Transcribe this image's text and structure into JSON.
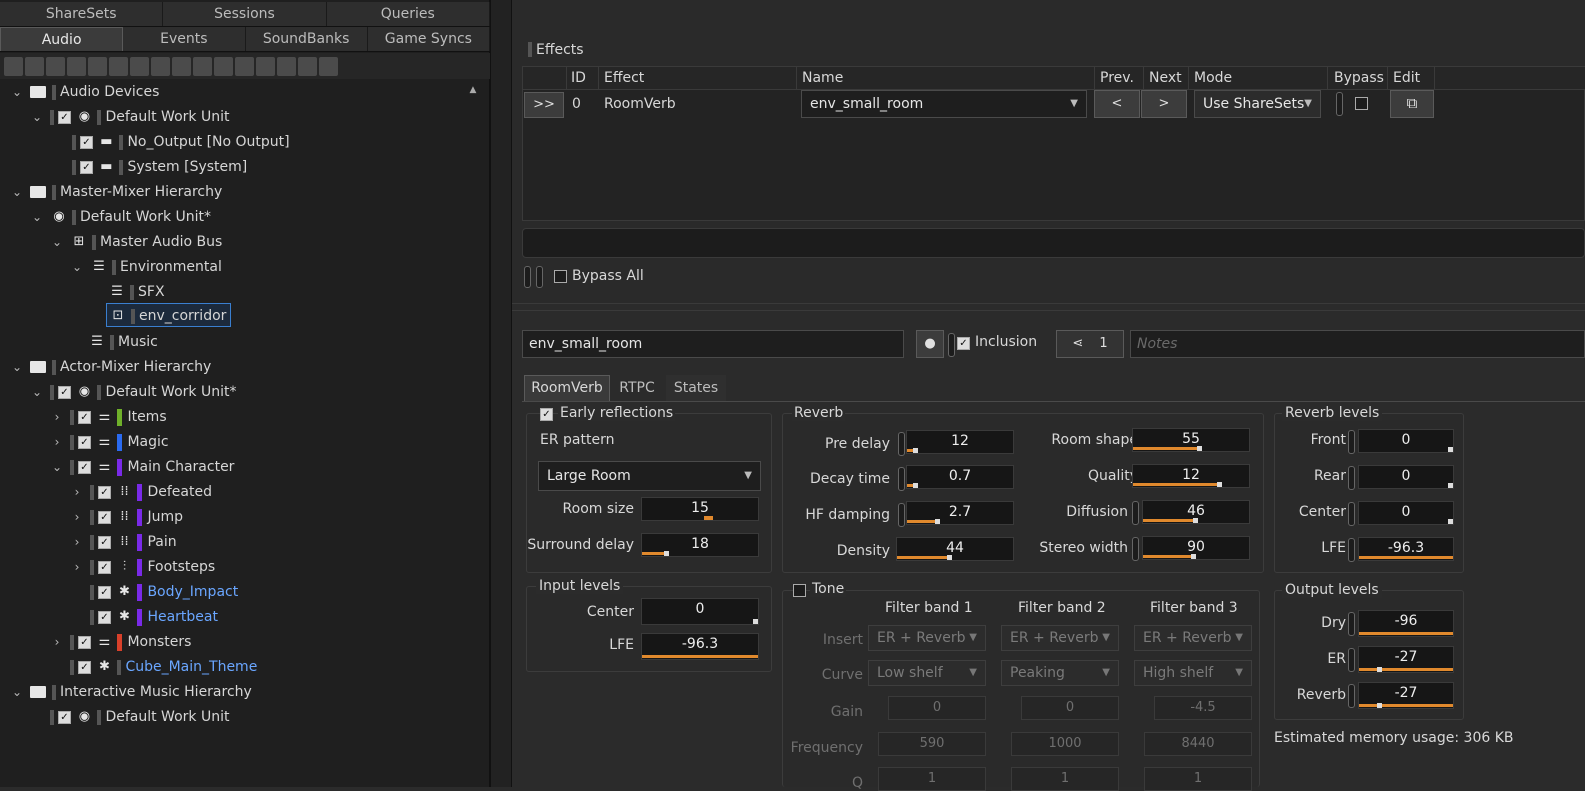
{
  "left_tabs_top": [
    "ShareSets",
    "Sessions",
    "Queries"
  ],
  "left_tabs_bottom": [
    "Audio",
    "Events",
    "SoundBanks",
    "Game Syncs"
  ],
  "tree": [
    {
      "label": "Audio Devices"
    },
    {
      "label": "Default Work Unit"
    },
    {
      "label": "No_Output [No Output]"
    },
    {
      "label": "System [System]"
    },
    {
      "label": "Master-Mixer Hierarchy"
    },
    {
      "label": "Default Work Unit*"
    },
    {
      "label": "Master Audio Bus"
    },
    {
      "label": "Environmental"
    },
    {
      "label": "SFX"
    },
    {
      "label": "env_corridor"
    },
    {
      "label": "Music"
    },
    {
      "label": "Actor-Mixer Hierarchy"
    },
    {
      "label": "Default Work Unit*"
    },
    {
      "label": "Items"
    },
    {
      "label": "Magic"
    },
    {
      "label": "Main Character"
    },
    {
      "label": "Defeated"
    },
    {
      "label": "Jump"
    },
    {
      "label": "Pain"
    },
    {
      "label": "Footsteps"
    },
    {
      "label": "Body_Impact"
    },
    {
      "label": "Heartbeat"
    },
    {
      "label": "Monsters"
    },
    {
      "label": "Cube_Main_Theme"
    },
    {
      "label": "Interactive Music Hierarchy"
    },
    {
      "label": "Default Work Unit"
    }
  ],
  "colors": {
    "items": "#6fb02a",
    "magic": "#2a6af0",
    "main_character": "#7a2ae8",
    "monsters": "#d8402a",
    "link": "#6aa6ff",
    "accent": "#e0892d"
  },
  "effects": {
    "title": "Effects",
    "headers": {
      "id": "ID",
      "effect": "Effect",
      "name": "Name",
      "prev": "Prev.",
      "next": "Next",
      "mode": "Mode",
      "bypass": "Bypass",
      "edit": "Edit"
    },
    "row": {
      "expand": ">>",
      "id": "0",
      "effect": "RoomVerb",
      "name": "env_small_room",
      "prev": "<",
      "next": ">",
      "mode": "Use ShareSets"
    },
    "bypass_all": "Bypass All"
  },
  "editor": {
    "name": "env_small_room",
    "inclusion": "Inclusion",
    "ref_count": "1",
    "notes_placeholder": "Notes",
    "tabs": [
      "RoomVerb",
      "RTPC",
      "States"
    ],
    "early": {
      "title": "Early reflections",
      "er_pattern_label": "ER pattern",
      "er_pattern": "Large Room",
      "room_size_label": "Room size",
      "room_size": "15",
      "surround_delay_label": "Surround delay",
      "surround_delay": "18"
    },
    "reverb": {
      "title": "Reverb",
      "pre_delay_label": "Pre delay",
      "pre_delay": "12",
      "decay_time_label": "Decay time",
      "decay_time": "0.7",
      "hf_damping_label": "HF damping",
      "hf_damping": "2.7",
      "density_label": "Density",
      "density": "44",
      "room_shape_label": "Room shape",
      "room_shape": "55",
      "quality_label": "Quality",
      "quality": "12",
      "diffusion_label": "Diffusion",
      "diffusion": "46",
      "stereo_width_label": "Stereo width",
      "stereo_width": "90"
    },
    "reverb_levels": {
      "title": "Reverb levels",
      "front_label": "Front",
      "front": "0",
      "rear_label": "Rear",
      "rear": "0",
      "center_label": "Center",
      "center": "0",
      "lfe_label": "LFE",
      "lfe": "-96.3"
    },
    "input_levels": {
      "title": "Input levels",
      "center_label": "Center",
      "center": "0",
      "lfe_label": "LFE",
      "lfe": "-96.3"
    },
    "tone": {
      "title": "Tone",
      "bands": [
        "Filter band 1",
        "Filter band 2",
        "Filter band 3"
      ],
      "insert_label": "Insert",
      "curve_label": "Curve",
      "gain_label": "Gain",
      "frequency_label": "Frequency",
      "q_label": "Q",
      "insert": [
        "ER + Reverb",
        "ER + Reverb",
        "ER + Reverb"
      ],
      "curve": [
        "Low shelf",
        "Peaking",
        "High shelf"
      ],
      "gain": [
        "0",
        "0",
        "-4.5"
      ],
      "frequency": [
        "590",
        "1000",
        "8440"
      ],
      "q": [
        "1",
        "1",
        "1"
      ]
    },
    "output_levels": {
      "title": "Output levels",
      "dry_label": "Dry",
      "dry": "-96",
      "er_label": "ER",
      "er": "-27",
      "reverb_label": "Reverb",
      "reverb": "-27"
    },
    "memory": "Estimated memory usage: 306 KB"
  }
}
